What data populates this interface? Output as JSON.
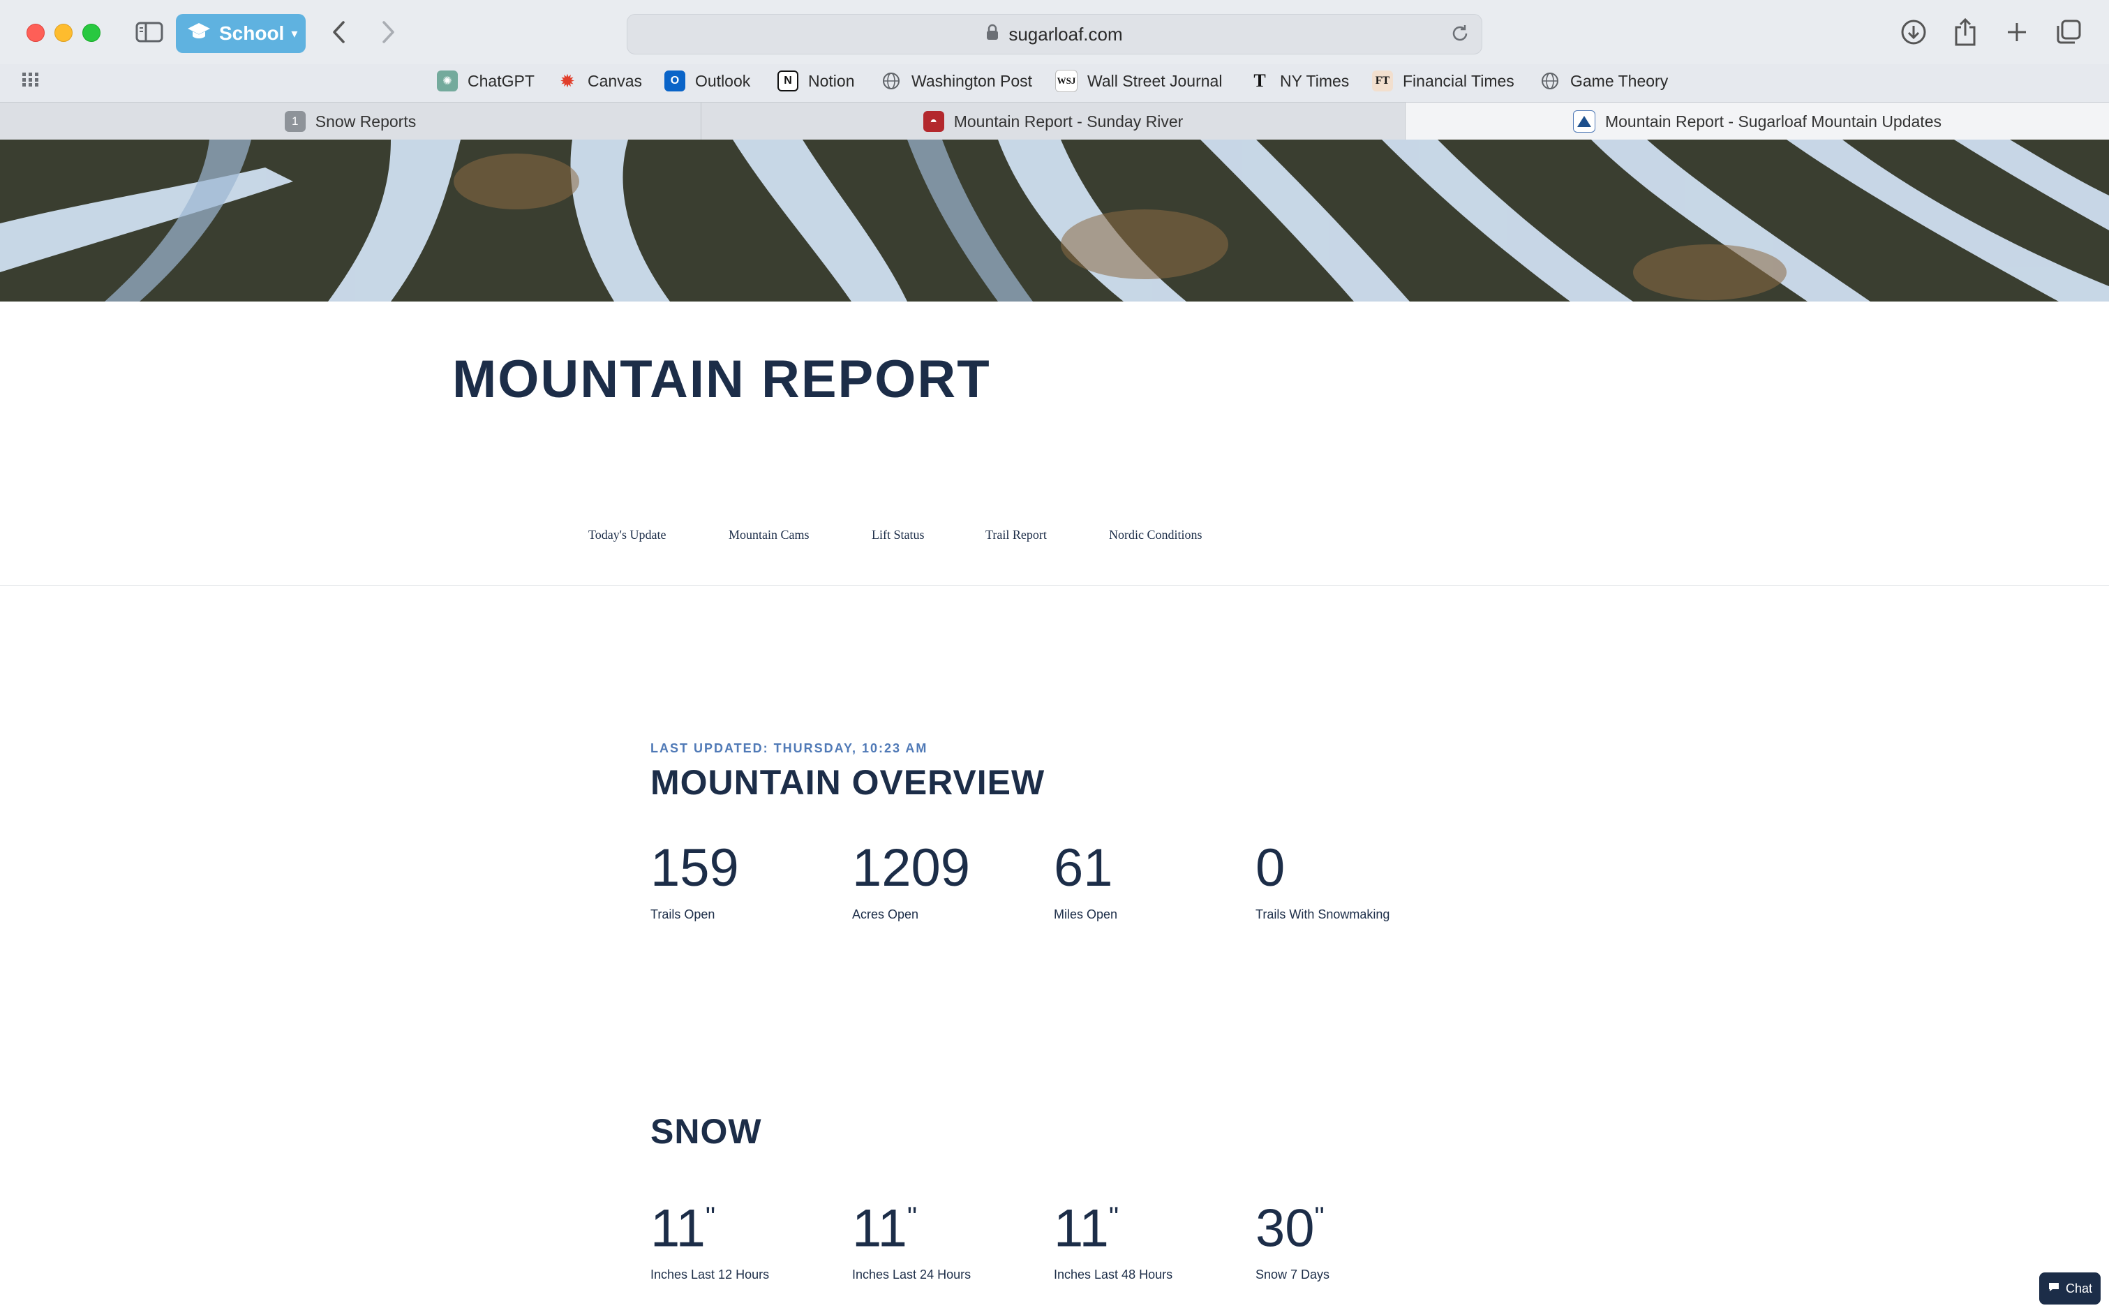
{
  "browser": {
    "profile_label": "School",
    "address": "sugarloaf.com",
    "bookmarks": [
      {
        "label": "ChatGPT",
        "icon": "chatgpt-icon",
        "color": "#74aa9c"
      },
      {
        "label": "Canvas",
        "icon": "canvas-icon",
        "color": "#e13f2b"
      },
      {
        "label": "Outlook",
        "icon": "outlook-icon",
        "color": "#0a64c8"
      },
      {
        "label": "Notion",
        "icon": "notion-icon",
        "color": "#111111"
      },
      {
        "label": "Washington Post",
        "icon": "globe-icon",
        "color": "#5f6368"
      },
      {
        "label": "Wall Street Journal",
        "icon": "wsj-icon",
        "color": "#111111"
      },
      {
        "label": "NY Times",
        "icon": "nytimes-icon",
        "color": "#111111"
      },
      {
        "label": "Financial Times",
        "icon": "ft-icon",
        "color": "#f2dfce"
      },
      {
        "label": "Game Theory",
        "icon": "globe-icon",
        "color": "#5f6368"
      }
    ],
    "tabs": [
      {
        "label": "Snow Reports",
        "badge": "1"
      },
      {
        "label": "Mountain Report - Sunday River"
      },
      {
        "label": "Mountain Report - Sugarloaf Mountain Updates"
      }
    ]
  },
  "page": {
    "title": "MOUNTAIN REPORT",
    "subnav": [
      "Today's Update",
      "Mountain Cams",
      "Lift Status",
      "Trail Report",
      "Nordic Conditions"
    ],
    "last_updated": "LAST UPDATED: THURSDAY, 10:23 AM",
    "overview": {
      "title": "MOUNTAIN OVERVIEW",
      "stats": [
        {
          "value": "159",
          "label": "Trails Open"
        },
        {
          "value": "1209",
          "label": "Acres Open"
        },
        {
          "value": "61",
          "label": "Miles Open"
        },
        {
          "value": "0",
          "label": "Trails With Snowmaking"
        }
      ]
    },
    "snow": {
      "title": "SNOW",
      "unit": "\"",
      "stats": [
        {
          "value": "11",
          "label": "Inches Last 12 Hours"
        },
        {
          "value": "11",
          "label": "Inches Last 24 Hours"
        },
        {
          "value": "11",
          "label": "Inches Last 48 Hours"
        },
        {
          "value": "30",
          "label": "Snow 7 Days"
        }
      ]
    },
    "chat_label": "Chat"
  },
  "colors": {
    "navy": "#1c2d48",
    "accent_blue": "#4f79b6",
    "profile": "#5fb2e0"
  }
}
